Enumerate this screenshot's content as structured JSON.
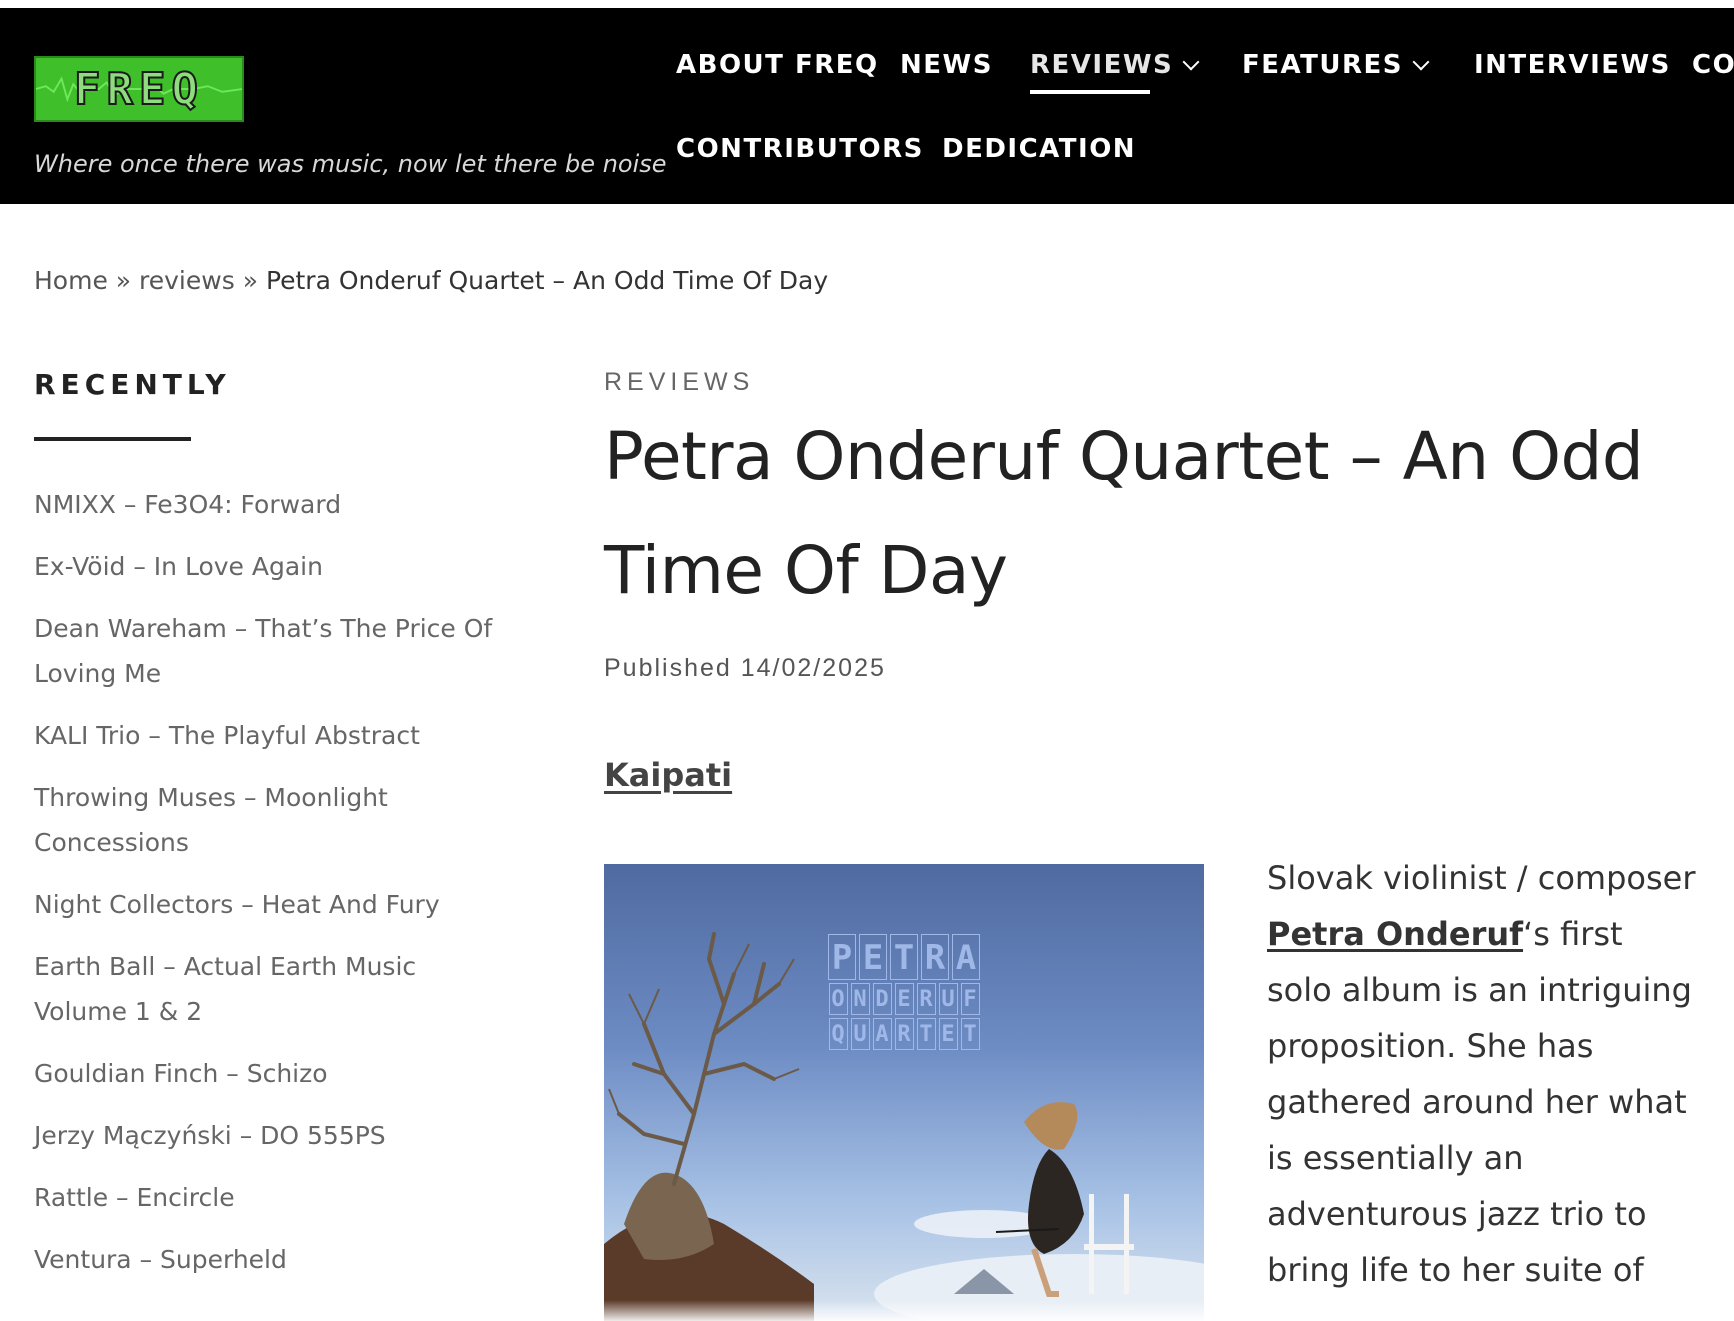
{
  "site": {
    "logo_text": "FREQ",
    "tagline": "Where once there was music, now let there be noise",
    "colors": {
      "header_bg": "#000000",
      "logo_green": "#3fbf2a"
    }
  },
  "nav": {
    "items": [
      {
        "label": "ABOUT FREQ"
      },
      {
        "label": "NEWS"
      },
      {
        "label": "REVIEWS",
        "active": true
      },
      {
        "label": "FEATURES"
      },
      {
        "label": "INTERVIEWS"
      },
      {
        "label": "COI"
      },
      {
        "label": "CONTRIBUTORS"
      },
      {
        "label": "DEDICATION"
      }
    ]
  },
  "breadcrumb": {
    "home": "Home",
    "sep": "»",
    "section": "reviews",
    "current": "Petra Onderuf Quartet – An Odd Time Of Day"
  },
  "sidebar": {
    "title": "RECENTLY",
    "items": [
      "NMIXX – Fe3O4: Forward",
      "Ex-Vöid – In Love Again",
      "Dean Wareham – That’s The Price Of Loving Me",
      "KALI Trio – The Playful Abstract",
      "Throwing Muses – Moonlight Concessions",
      "Night Collectors – Heat And Fury",
      "Earth Ball – Actual Earth Music Volume 1 & 2",
      "Gouldian Finch – Schizo",
      "Jerzy Mączyński – DO 555PS",
      "Rattle – Encircle",
      "Ventura – Superheld"
    ]
  },
  "post": {
    "category": "REVIEWS",
    "title": "Petra Onderuf Quartet – An Odd Time Of Day",
    "published": "Published 14/02/2025",
    "label": "Kaipati",
    "cover_letters": {
      "row1": [
        "P",
        "E",
        "T",
        "R",
        "A"
      ],
      "row2": [
        "O",
        "N",
        "D",
        "E",
        "R",
        "U",
        "F"
      ],
      "row3": [
        "Q",
        "U",
        "A",
        "R",
        "T",
        "E",
        "T"
      ]
    },
    "body_before": "Slovak violinist / composer ",
    "body_link": "Petra Onderuf",
    "body_after": "‘s first solo album is an intriguing proposition. She has gathered around her what is essentially an adventurous jazz trio to bring life to her suite of"
  }
}
